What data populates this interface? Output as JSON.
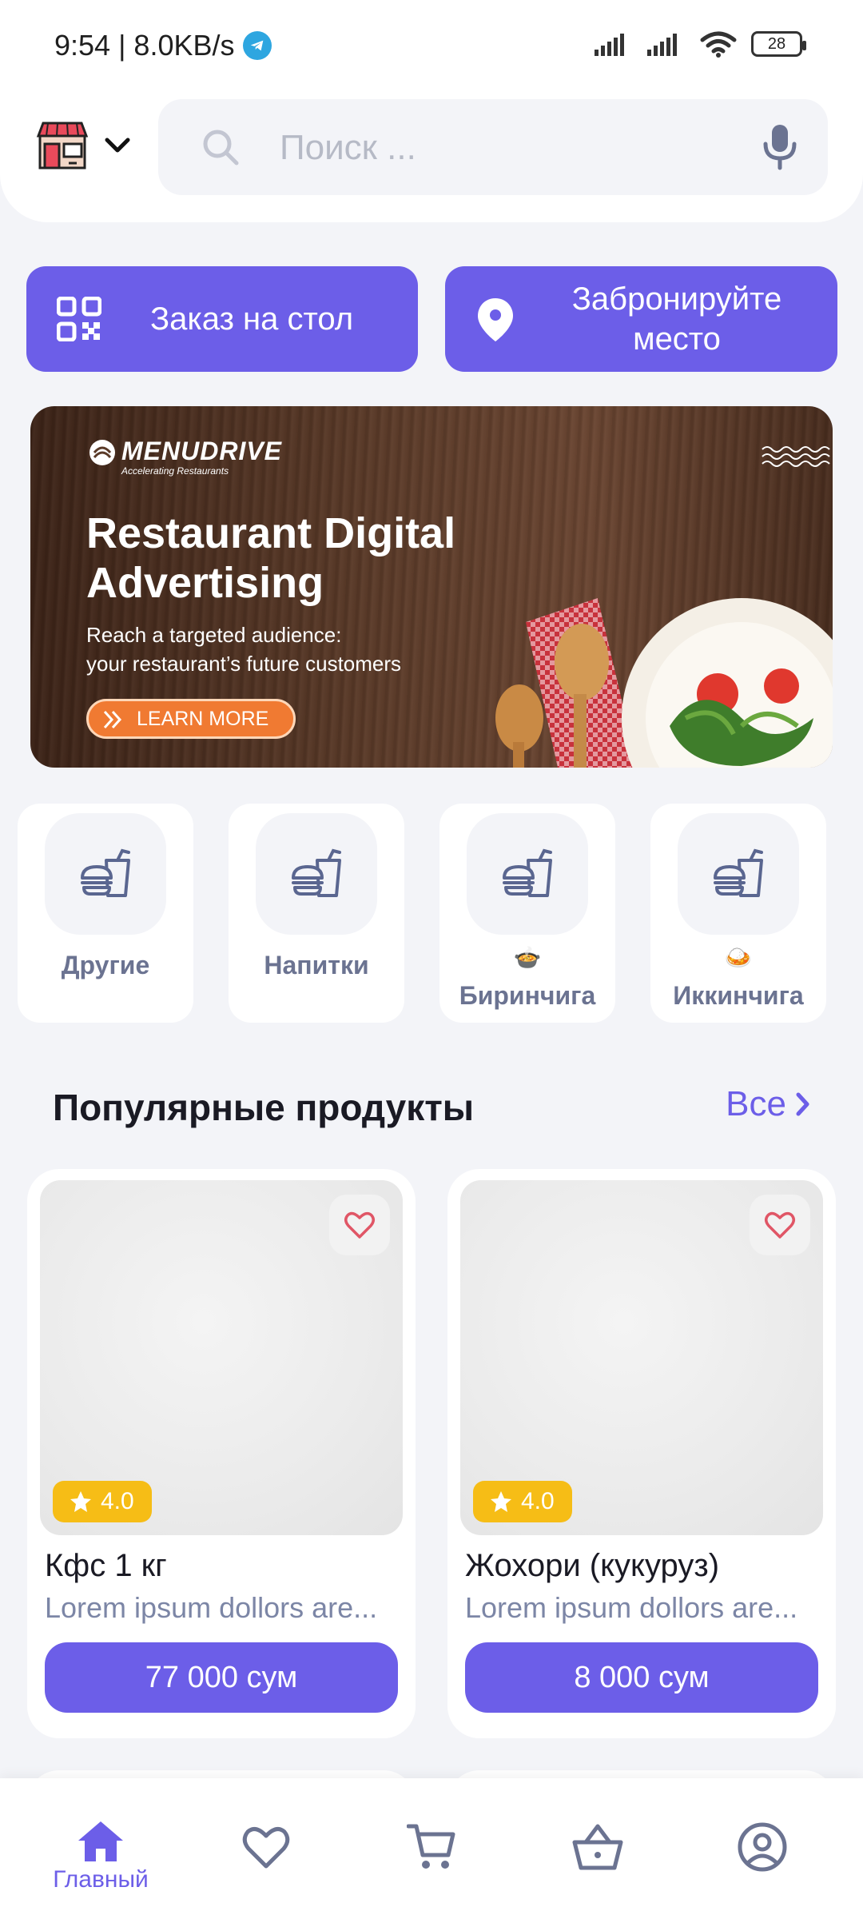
{
  "status_bar": {
    "time_speed": "9:54 | 8.0KB/s",
    "battery": "28"
  },
  "header": {
    "search_placeholder": "Поиск ..."
  },
  "actions": {
    "order_label": "Заказ на стол",
    "book_label_line1": "Забронируйте",
    "book_label_line2": "место"
  },
  "banner": {
    "brand": "MENUDRIVE",
    "brand_tagline": "Accelerating Restaurants",
    "title_line1": "Restaurant Digital",
    "title_line2": "Advertising",
    "subtitle_line1": "Reach a targeted audience:",
    "subtitle_line2": "your restaurant’s future customers",
    "button": "LEARN MORE"
  },
  "categories": [
    {
      "label": "Другие",
      "emoji": ""
    },
    {
      "label": "Напитки",
      "emoji": ""
    },
    {
      "label": "Биринчига",
      "emoji": "🍲"
    },
    {
      "label": "Иккинчига",
      "emoji": "🍛"
    }
  ],
  "section": {
    "title": "Популярные продукты",
    "all": "Все"
  },
  "products": [
    {
      "name": "Кфс 1 кг",
      "description": "Lorem ipsum dollors are...",
      "price": "77 000 сум",
      "rating": "4.0"
    },
    {
      "name": "Жохори  (кукуруз)",
      "description": "Lorem ipsum dollors are...",
      "price": "8 000 сум",
      "rating": "4.0"
    }
  ],
  "bottom_nav": {
    "home_label": "Главный",
    "icons": [
      "home-icon",
      "heart-icon",
      "cart-icon",
      "basket-icon",
      "profile-icon"
    ]
  },
  "colors": {
    "accent": "#6c5ee8",
    "rating": "#f6bd16",
    "muted_text": "#7c86a6",
    "background": "#f3f4f8"
  }
}
